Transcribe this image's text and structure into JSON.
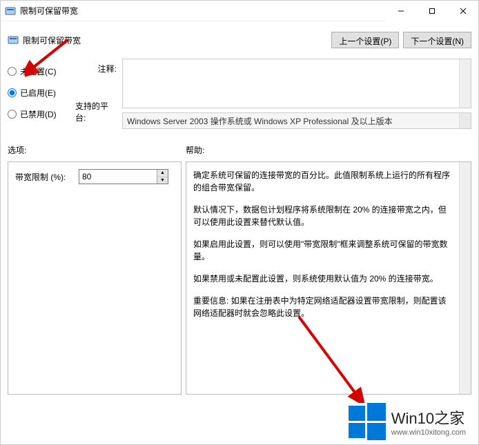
{
  "titlebar": {
    "title": "限制可保留带宽"
  },
  "header": {
    "title": "限制可保留带宽",
    "prev_btn": "上一个设置(P)",
    "next_btn": "下一个设置(N)"
  },
  "radios": {
    "not_configured": "未配置(C)",
    "enabled": "已启用(E)",
    "disabled": "已禁用(D)",
    "selected": "enabled"
  },
  "labels": {
    "comment": "注释:",
    "platform": "支持的平台:",
    "options": "选项:",
    "help": "帮助:"
  },
  "platform_text": "Windows Server 2003 操作系统或 Windows XP Professional 及以上版本",
  "options_panel": {
    "bandwidth_label": "带宽限制 (%):",
    "bandwidth_value": "80"
  },
  "help_panel": {
    "p1": "确定系统可保留的连接带宽的百分比。此值限制系统上运行的所有程序的组合带宽保留。",
    "p2": "默认情况下，数据包计划程序将系统限制在 20% 的连接带宽之内，但可以使用此设置来替代默认值。",
    "p3": "如果启用此设置，则可以使用\"带宽限制\"框来调整系统可保留的带宽数量。",
    "p4": "如果禁用或未配置此设置，则系统使用默认值为 20% 的连接带宽。",
    "p5": "重要信息: 如果在注册表中为特定网络适配器设置带宽限制，则配置该网络适配器时就会忽略此设置。"
  },
  "watermark": {
    "brand": "Win10之家",
    "url": "www.win10xitong.com"
  }
}
